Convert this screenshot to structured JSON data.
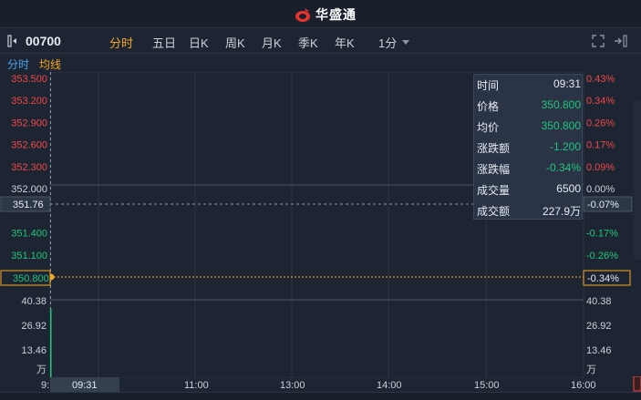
{
  "app": {
    "brand": "华盛通"
  },
  "toolbar": {
    "stock_code": "00700",
    "periods": [
      {
        "label": "分时",
        "active": true
      },
      {
        "label": "五日",
        "active": false
      },
      {
        "label": "日K",
        "active": false
      },
      {
        "label": "周K",
        "active": false
      },
      {
        "label": "月K",
        "active": false
      },
      {
        "label": "季K",
        "active": false
      },
      {
        "label": "年K",
        "active": false
      },
      {
        "label": "1分",
        "active": false
      }
    ]
  },
  "subtabs": {
    "time_share": "分时",
    "avg_line": "均线"
  },
  "price_axis": {
    "left": [
      "353.500",
      "353.200",
      "352.900",
      "352.600",
      "352.300",
      "352.000",
      "351.760",
      "351.400",
      "351.100",
      "350.800"
    ],
    "right": [
      "0.43%",
      "0.34%",
      "0.26%",
      "0.17%",
      "0.09%",
      "0.00%",
      "-0.07%",
      "-0.17%",
      "-0.26%",
      "-0.34%"
    ]
  },
  "volume_axis": {
    "left": [
      "40.38",
      "26.92",
      "13.46",
      "万"
    ],
    "right": [
      "40.38",
      "26.92",
      "13.46",
      "万"
    ]
  },
  "time_axis": {
    "start_partial": "9:",
    "current": "09:31",
    "ticks": [
      "11:00",
      "13:00",
      "14:00",
      "15:00",
      "16:00"
    ]
  },
  "chart_data": {
    "type": "line",
    "x": [
      "09:31"
    ],
    "series": [
      {
        "values": [
          350.8
        ]
      }
    ],
    "volume": [
      0.65
    ],
    "previous_close": 352.0,
    "crosshair_price": 351.76,
    "crosshair_pct": "-0.07%",
    "current_price_label": "350.800",
    "current_pct_label": "-0.34%"
  },
  "info_panel": {
    "rows": [
      {
        "label": "时间",
        "value": "09:31"
      },
      {
        "label": "价格",
        "value": "350.800"
      },
      {
        "label": "均价",
        "value": "350.800"
      },
      {
        "label": "涨跌额",
        "value": "-1.200"
      },
      {
        "label": "涨跌幅",
        "value": "-0.34%"
      },
      {
        "label": "成交量",
        "value": "6500"
      },
      {
        "label": "成交额",
        "value": "227.9万"
      }
    ]
  },
  "colors": {
    "up": "#f04848",
    "down": "#1fc57a",
    "flat": "#c9d1dc",
    "accent": "#f5a623",
    "link": "#4aa3f0",
    "background": "#1e2532"
  }
}
